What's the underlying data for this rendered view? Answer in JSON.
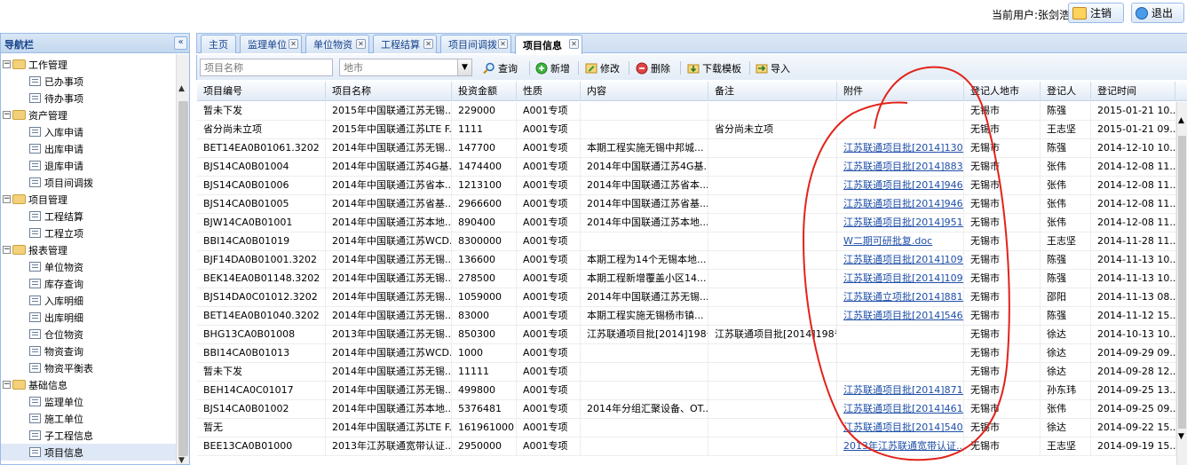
{
  "header": {
    "current_user": "当前用户:张剑浩",
    "logout_label": "注销",
    "exit_label": "退出"
  },
  "sidebar": {
    "title": "导航栏",
    "collapse_icon": "«",
    "groups": [
      {
        "label": "工作管理",
        "items": [
          "已办事项",
          "待办事项"
        ]
      },
      {
        "label": "资产管理",
        "items": [
          "入库申请",
          "出库申请",
          "退库申请",
          "项目间调拨"
        ]
      },
      {
        "label": "项目管理",
        "items": [
          "工程结算",
          "工程立项"
        ]
      },
      {
        "label": "报表管理",
        "items": [
          "单位物资",
          "库存查询",
          "入库明细",
          "出库明细",
          "仓位物资",
          "物资查询",
          "物资平衡表"
        ]
      },
      {
        "label": "基础信息",
        "items": [
          "监理单位",
          "施工单位",
          "子工程信息",
          "项目信息"
        ]
      }
    ]
  },
  "tabs": [
    {
      "label": "主页",
      "closable": false,
      "active": false
    },
    {
      "label": "监理单位",
      "closable": true,
      "active": false
    },
    {
      "label": "单位物资",
      "closable": true,
      "active": false
    },
    {
      "label": "工程结算",
      "closable": true,
      "active": false
    },
    {
      "label": "项目间调拨",
      "closable": true,
      "active": false
    },
    {
      "label": "项目信息",
      "closable": true,
      "active": true
    }
  ],
  "toolbar": {
    "name_placeholder": "项目名称",
    "city_placeholder": "地市",
    "query_label": "查询",
    "add_label": "新增",
    "edit_label": "修改",
    "delete_label": "删除",
    "download_label": "下载模板",
    "import_label": "导入"
  },
  "grid": {
    "columns": [
      "项目编号",
      "项目名称",
      "投资金额",
      "性质",
      "内容",
      "备注",
      "附件",
      "登记人地市",
      "登记人",
      "登记时间"
    ],
    "rows": [
      [
        "暂未下发",
        "2015年中国联通江苏无锡...",
        "229000",
        "A001专项",
        "",
        "",
        "",
        "无锡市",
        "陈强",
        "2015-01-21 10..."
      ],
      [
        "省分尚未立项",
        "2015年中国联通江苏LTE F...",
        "1111",
        "A001专项",
        "",
        "省分尚未立项",
        "",
        "无锡市",
        "王志坚",
        "2015-01-21 09..."
      ],
      [
        "BET14EA0B01061.3202",
        "2014年中国联通江苏无锡...",
        "147700",
        "A001专项",
        "本期工程实施无锡中邦城...",
        "",
        "江苏联通项目批[2014]130...",
        "无锡市",
        "陈强",
        "2014-12-10 10..."
      ],
      [
        "BJS14CA0B01004",
        "2014年中国联通江苏4G基...",
        "1474400",
        "A001专项",
        "2014年中国联通江苏4G基...",
        "",
        "江苏联通项目批[2014]883...",
        "无锡市",
        "张伟",
        "2014-12-08 11..."
      ],
      [
        "BJS14CA0B01006",
        "2014年中国联通江苏省本...",
        "1213100",
        "A001专项",
        "2014年中国联通江苏省本...",
        "",
        "江苏联通项目批[2014]946...",
        "无锡市",
        "张伟",
        "2014-12-08 11..."
      ],
      [
        "BJS14CA0B01005",
        "2014年中国联通江苏省基...",
        "2966600",
        "A001专项",
        "2014年中国联通江苏省基...",
        "",
        "江苏联通项目批[2014]946...",
        "无锡市",
        "张伟",
        "2014-12-08 11..."
      ],
      [
        "BJW14CA0B01001",
        "2014年中国联通江苏本地...",
        "890400",
        "A001专项",
        "2014年中国联通江苏本地...",
        "",
        "江苏联通项目批[2014]951...",
        "无锡市",
        "张伟",
        "2014-12-08 11..."
      ],
      [
        "BBI14CA0B01019",
        "2014年中国联通江苏WCD...",
        "8300000",
        "A001专项",
        "",
        "",
        "W二期可研批复.doc",
        "无锡市",
        "王志坚",
        "2014-11-28 11..."
      ],
      [
        "BJF14DA0B01001.3202",
        "2014年中国联通江苏无锡...",
        "136600",
        "A001专项",
        "本期工程为14个无锡本地...",
        "",
        "江苏联通项目批[2014]109...",
        "无锡市",
        "陈强",
        "2014-11-13 10..."
      ],
      [
        "BEK14EA0B01148.3202",
        "2014年中国联通江苏无锡...",
        "278500",
        "A001专项",
        "本期工程新增覆盖小区14...",
        "",
        "江苏联通项目批[2014]109...",
        "无锡市",
        "陈强",
        "2014-11-13 10..."
      ],
      [
        "BJS14DA0C01012.3202",
        "2014年中国联通江苏无锡...",
        "1059000",
        "A001专项",
        "2014年中国联通江苏无锡...",
        "",
        "江苏联通立项批[2014]881...",
        "无锡市",
        "邵阳",
        "2014-11-13 08..."
      ],
      [
        "BET14EA0B01040.3202",
        "2014年中国联通江苏无锡...",
        "83000",
        "A001专项",
        "本期工程实施无锡杨市镇...",
        "",
        "江苏联通项目批[2014]546...",
        "无锡市",
        "陈强",
        "2014-11-12 15..."
      ],
      [
        "BHG13CA0B01008",
        "2013年中国联通江苏无锡...",
        "850300",
        "A001专项",
        "江苏联通项目批[2014]198号",
        "江苏联通项目批[2014]198号",
        "",
        "无锡市",
        "徐达",
        "2014-10-13 10..."
      ],
      [
        "BBI14CA0B01013",
        "2014年中国联通江苏WCD...",
        "1000",
        "A001专项",
        "",
        "",
        "",
        "无锡市",
        "徐达",
        "2014-09-29 09..."
      ],
      [
        "暂未下发",
        "2014年中国联通江苏无锡...",
        "11111",
        "A001专项",
        "",
        "",
        "",
        "无锡市",
        "徐达",
        "2014-09-28 12..."
      ],
      [
        "BEH14CA0C01017",
        "2014年中国联通江苏无锡...",
        "499800",
        "A001专项",
        "",
        "",
        "江苏联通项目批[2014]871...",
        "无锡市",
        "孙东玮",
        "2014-09-25 13..."
      ],
      [
        "BJS14CA0B01002",
        "2014年中国联通江苏本地...",
        "5376481",
        "A001专项",
        "2014年分组汇聚设备、OT...",
        "",
        "江苏联通项目批[2014]461...",
        "无锡市",
        "张伟",
        "2014-09-25 09..."
      ],
      [
        "暂无",
        "2014年中国联通江苏LTE F...",
        "161961000",
        "A001专项",
        "",
        "",
        "江苏联通项目批[2014]540...",
        "无锡市",
        "徐达",
        "2014-09-22 15..."
      ],
      [
        "BEE13CA0B01000",
        "2013年江苏联通宽带认证...",
        "2950000",
        "A001专项",
        "",
        "",
        "2013年江苏联通宽带认证...",
        "无锡市",
        "王志坚",
        "2014-09-19 15..."
      ]
    ],
    "link_column": 6
  },
  "colors": {
    "border": "#99bbe8",
    "link": "#1f4fa8",
    "annotation": "#e2231a"
  }
}
